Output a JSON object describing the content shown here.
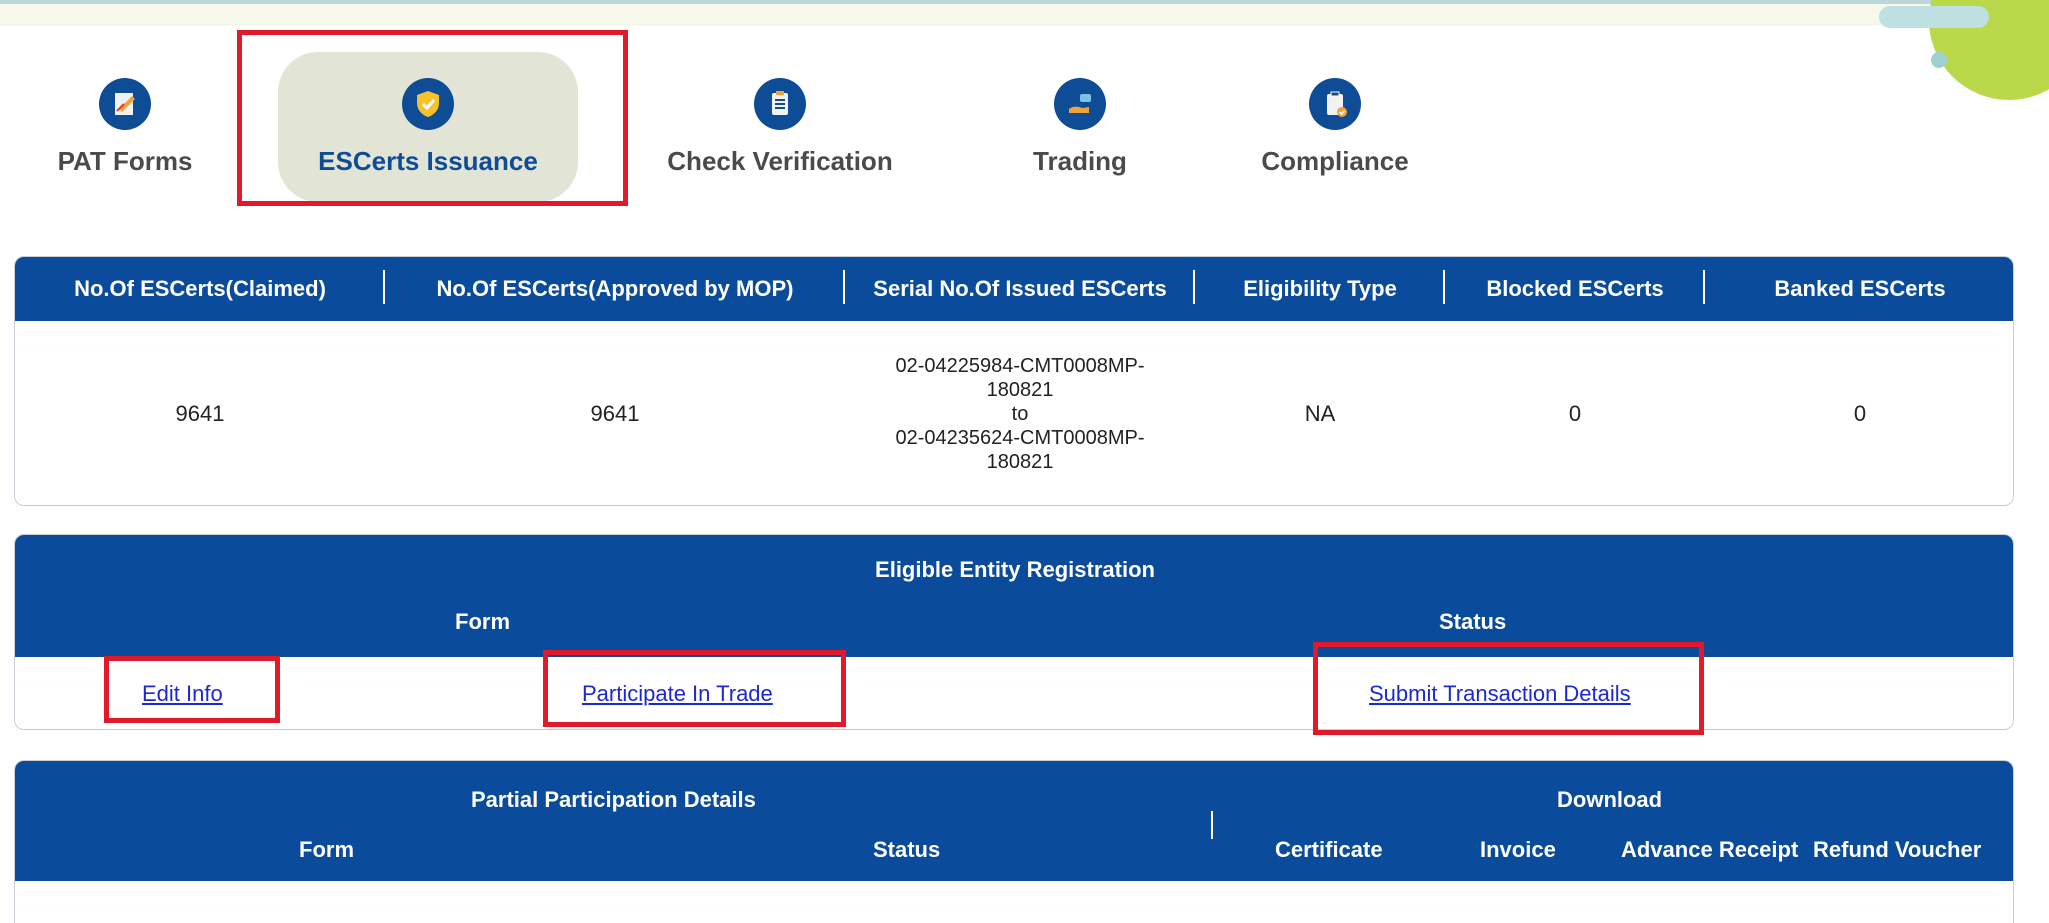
{
  "tabs": [
    {
      "label": "PAT Forms",
      "icon": "edit-form-icon"
    },
    {
      "label": "ESCerts Issuance",
      "icon": "shield-check-icon",
      "active": true
    },
    {
      "label": "Check Verification",
      "icon": "checklist-icon"
    },
    {
      "label": "Trading",
      "icon": "trade-hand-icon"
    },
    {
      "label": "Compliance",
      "icon": "clipboard-check-icon"
    }
  ],
  "escerts_table": {
    "headers": [
      "No.Of ESCerts(Claimed)",
      "No.Of ESCerts(Approved by MOP)",
      "Serial No.Of Issued ESCerts",
      "Eligibility Type",
      "Blocked ESCerts",
      "Banked ESCerts"
    ],
    "row": {
      "claimed": "9641",
      "approved": "9641",
      "serial_from_1": "02-04225984-CMT0008MP-",
      "serial_from_2": "180821",
      "serial_to": "to",
      "serial_to_1": "02-04235624-CMT0008MP-",
      "serial_to_2": "180821",
      "eligibility": "NA",
      "blocked": "0",
      "banked": "0"
    }
  },
  "registration": {
    "title": "Eligible Entity Registration",
    "col_form": "Form",
    "col_status": "Status",
    "links": {
      "edit_info": "Edit Info",
      "participate": "Participate In Trade",
      "submit_txn": "Submit Transaction Details"
    }
  },
  "partial": {
    "title": "Partial Participation Details",
    "download": "Download",
    "col_form": "Form",
    "col_status": "Status",
    "col_certificate": "Certificate",
    "col_invoice": "Invoice",
    "col_advance": "Advance Receipt",
    "col_refund": "Refund Voucher"
  },
  "colors": {
    "header_blue": "#0b4b9b",
    "highlight_red": "#e0192b",
    "link_blue": "#1c28d4"
  }
}
